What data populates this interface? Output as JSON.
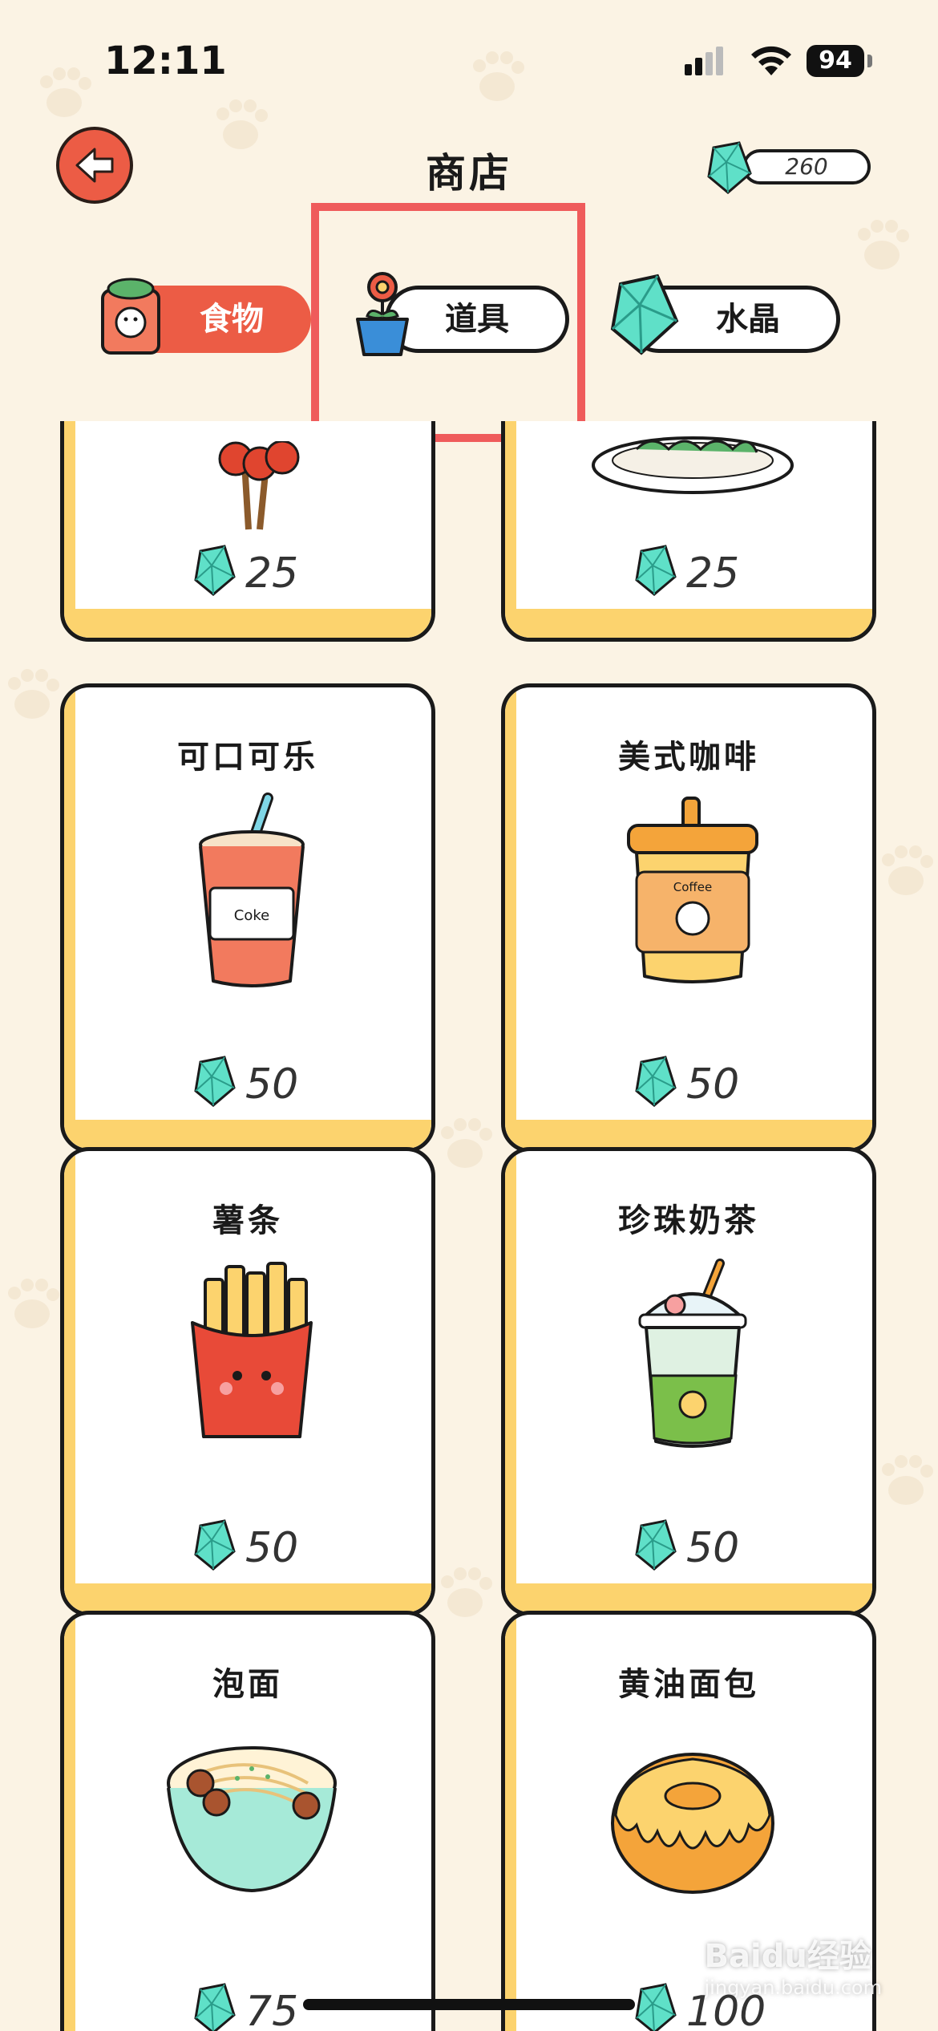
{
  "status_bar": {
    "time": "12:11",
    "battery": "94"
  },
  "header": {
    "title": "商店",
    "gem_balance": "260"
  },
  "tabs": [
    {
      "label": "食物",
      "selected": true
    },
    {
      "label": "道具",
      "selected": false
    },
    {
      "label": "水晶",
      "selected": false
    }
  ],
  "items": [
    {
      "name": "",
      "price": "25",
      "icon": "candied-hawthorn-icon"
    },
    {
      "name": "",
      "price": "25",
      "icon": "sushi-plate-icon"
    },
    {
      "name": "可口可乐",
      "price": "50",
      "icon": "cola-cup-icon"
    },
    {
      "name": "美式咖啡",
      "price": "50",
      "icon": "coffee-cup-icon"
    },
    {
      "name": "薯条",
      "price": "50",
      "icon": "fries-icon"
    },
    {
      "name": "珍珠奶茶",
      "price": "50",
      "icon": "bubble-tea-icon"
    },
    {
      "name": "泡面",
      "price": "75",
      "icon": "noodle-bowl-icon"
    },
    {
      "name": "黄油面包",
      "price": "100",
      "icon": "butter-bread-icon"
    }
  ],
  "watermark": {
    "brand": "Baidu经验",
    "url": "jingyan.baidu.com"
  },
  "colors": {
    "accent": "#ec5c45",
    "card_shadow": "#fcd36e",
    "gem": "#5fe0c8",
    "highlight": "#ef5b5b"
  }
}
